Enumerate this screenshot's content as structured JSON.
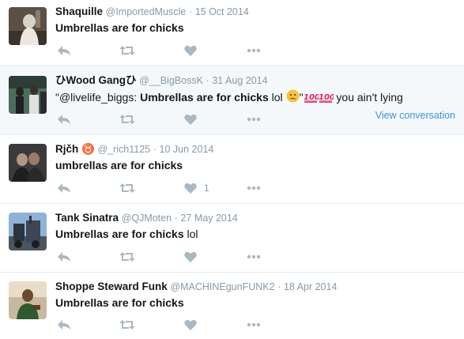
{
  "tweets": [
    {
      "name": "Shaquille",
      "handle": "@ImportedMuscle",
      "date": "15 Oct 2014",
      "text": "Umbrellas are for chicks",
      "likes": ""
    },
    {
      "name": "ひWood Gangひ",
      "handle": "@__BigBossK",
      "date": "31 Aug 2014",
      "text_prefix": "\"@livelife_biggs: ",
      "text_bold": "Umbrellas are for chicks",
      "text_after": " lol ",
      "text_quote_end": "\"",
      "text_suffix": " you ain't lying",
      "emoji_icons": [
        "confused-face-icon",
        "hundred-points-icon",
        "hundred-points-icon"
      ],
      "view_conversation": "View conversation",
      "likes": ""
    },
    {
      "name": "Rjčh ♉",
      "handle": "@_rich1125",
      "date": "10 Jun 2014",
      "text": "umbrellas are for chicks",
      "likes": "1"
    },
    {
      "name": "Tank Sinatra",
      "handle": "@QJMoten",
      "date": "27 May 2014",
      "text": "Umbrellas are for chicks",
      "text_suffix": " lol",
      "likes": ""
    },
    {
      "name": "Shoppe Steward Funk",
      "handle": "@MACHINEgunFUNK2",
      "date": "18 Apr 2014",
      "text": "Umbrellas are for chicks",
      "likes": ""
    }
  ],
  "separator": "·",
  "icons": [
    "reply-icon",
    "retweet-icon",
    "like-icon",
    "more-icon"
  ],
  "colors": {
    "accent": "#3b94d9",
    "muted": "#8899a6",
    "icon": "#aab8c2",
    "highlight_bg": "#f5f8fa",
    "border": "#e6ecf0"
  }
}
